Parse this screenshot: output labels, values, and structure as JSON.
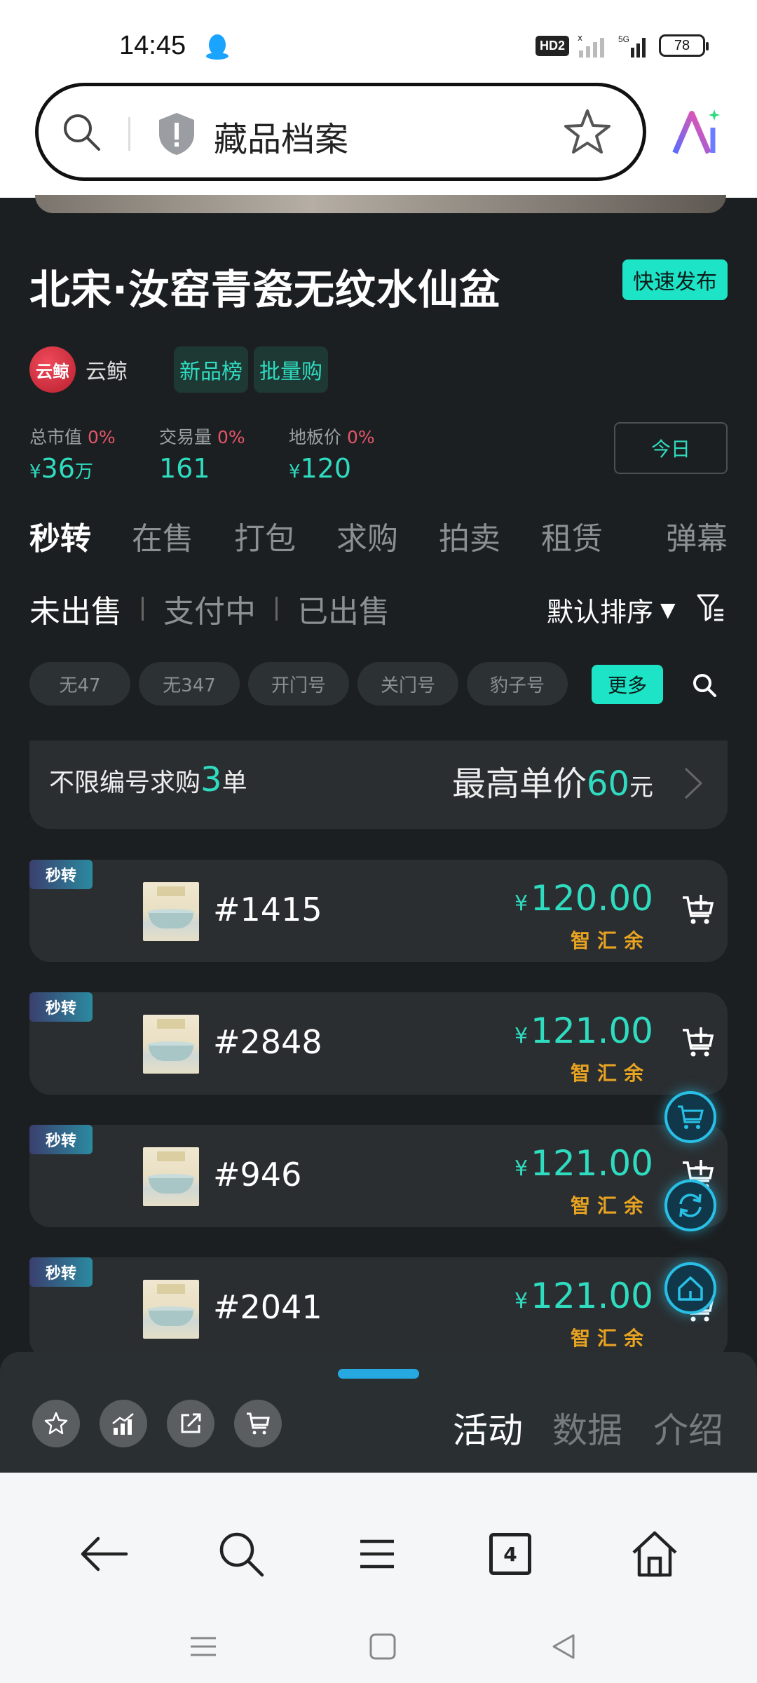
{
  "status": {
    "time": "14:45",
    "hd": "HD2",
    "network": "5G",
    "battery": "78"
  },
  "browser": {
    "url_title": "藏品档案"
  },
  "header": {
    "title": "北宋·汝窑青瓷无纹水仙盆",
    "quick_publish": "快速发布",
    "brand_logo": "云鲸",
    "brand_name": "云鲸",
    "tag_new": "新品榜",
    "tag_bulk": "批量购"
  },
  "stats": [
    {
      "label": "总市值",
      "pct": "0%",
      "prefix": "¥",
      "value": "36",
      "unit": "万"
    },
    {
      "label": "交易量",
      "pct": "0%",
      "prefix": "",
      "value": "161",
      "unit": ""
    },
    {
      "label": "地板价",
      "pct": "0%",
      "prefix": "¥",
      "value": "120",
      "unit": ""
    }
  ],
  "today": "今日",
  "tabs": [
    "秒转",
    "在售",
    "打包",
    "求购",
    "拍卖",
    "租赁",
    "弹幕"
  ],
  "subtabs": [
    "未出售",
    "支付中",
    "已出售"
  ],
  "sort": "默认排序",
  "chips": [
    "无47",
    "无347",
    "开门号",
    "关门号",
    "豹子号"
  ],
  "more": "更多",
  "buy_request": {
    "prefix": "不限编号求购",
    "count": "3",
    "suffix": "单",
    "price_label": "最高单价",
    "price": "60",
    "unit": "元"
  },
  "items": [
    {
      "badge": "秒转",
      "no": "#1415",
      "price": "120.00",
      "pay": "智汇余"
    },
    {
      "badge": "秒转",
      "no": "#2848",
      "price": "121.00",
      "pay": "智汇余"
    },
    {
      "badge": "秒转",
      "no": "#946",
      "price": "121.00",
      "pay": "智汇余"
    },
    {
      "badge": "秒转",
      "no": "#2041",
      "price": "121.00",
      "pay": "智汇余"
    }
  ],
  "currency": "¥",
  "panel_tabs": [
    "活动",
    "数据",
    "介绍"
  ],
  "nav": {
    "tabs_count": "4"
  },
  "colors": {
    "accent": "#1de4c6",
    "price": "#2fdcc0",
    "pay": "#e8a321",
    "bg": "#1c1f21"
  }
}
